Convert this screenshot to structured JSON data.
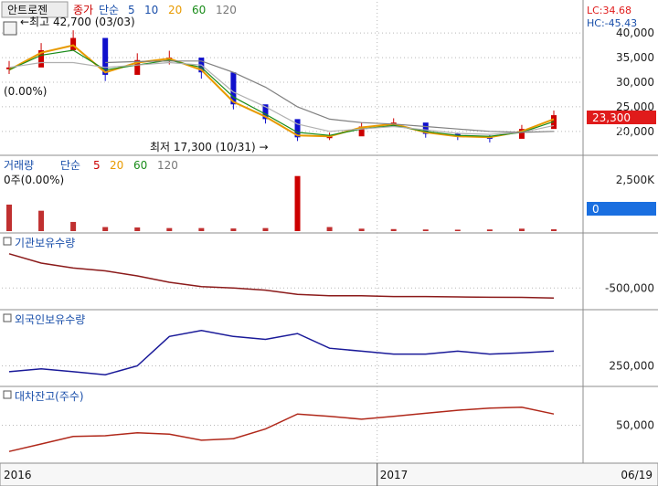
{
  "colors": {
    "price": "#cc0000",
    "price_down": "#1010cc",
    "ma5": "#e89a00",
    "ma10": "#1a8c1a",
    "ma20": "#b0b0b0",
    "inst": "#8b1a1a",
    "foreign": "#1a1a99",
    "loan": "#b0281a",
    "grid": "#b8b8b8",
    "label_blue": "#1a4faa",
    "badge_red": "#e01b1b",
    "badge_blue": "#1a6fe0"
  },
  "header": {
    "title": "안트로젠",
    "close_label": "종가",
    "ma_type": "단순",
    "ma_periods": [
      "5",
      "10",
      "20",
      "60",
      "120"
    ],
    "lc": "LC:34.68",
    "hc": "HC:-45.43"
  },
  "price_panel": {
    "high_label": "최고 42,700 (03/03)",
    "low_label": "최저 17,300 (10/31)",
    "change_label": "(0.00%)",
    "current_price": "23,300",
    "current_change": "0.00%",
    "y_ticks": [
      "40,000",
      "35,000",
      "30,000",
      "25,000",
      "20,000"
    ]
  },
  "volume_panel": {
    "title": "거래량",
    "ma_type": "단순",
    "ma_periods": [
      "5",
      "20",
      "60",
      "120"
    ],
    "sub_label": "0주(0.00%)",
    "current": "0",
    "current_change": "0.00%",
    "y_tick": "2,500K"
  },
  "inst_panel": {
    "title": "기관보유수량",
    "y_tick": "-500,000"
  },
  "foreign_panel": {
    "title": "외국인보유수량",
    "y_tick": "250,000"
  },
  "loan_panel": {
    "title": "대차잔고(주수)",
    "y_tick": "50,000"
  },
  "x_axis": {
    "labels": [
      "2016",
      "2017"
    ],
    "last_date": "06/19"
  },
  "chart_data": [
    {
      "type": "line",
      "title": "안트로젠 종가",
      "x": [
        "2016-01",
        "2016-02",
        "2016-03",
        "2016-04",
        "2016-05",
        "2016-06",
        "2016-07",
        "2016-08",
        "2016-09",
        "2016-10",
        "2016-11",
        "2016-12",
        "2017-01",
        "2017-02",
        "2017-03",
        "2017-04",
        "2017-05",
        "2017-06"
      ],
      "series": [
        {
          "name": "종가",
          "values": [
            33000,
            36500,
            39000,
            31500,
            34500,
            35000,
            32000,
            25500,
            22500,
            18800,
            19000,
            21000,
            21800,
            19500,
            19000,
            18500,
            20500,
            23300
          ]
        },
        {
          "name": "5",
          "values": [
            32500,
            36000,
            37500,
            32000,
            34000,
            34800,
            32500,
            26000,
            23000,
            19200,
            19000,
            20800,
            21500,
            19800,
            19000,
            18800,
            20000,
            22500
          ]
        },
        {
          "name": "10",
          "values": [
            32500,
            35500,
            36500,
            32500,
            33500,
            34500,
            33000,
            27000,
            23500,
            19800,
            19200,
            20500,
            21200,
            20000,
            19200,
            19000,
            19800,
            22000
          ]
        },
        {
          "name": "20",
          "values": [
            33000,
            34000,
            34000,
            33000,
            33500,
            34000,
            33500,
            28000,
            25000,
            21500,
            20000,
            20500,
            21000,
            20300,
            19600,
            19400,
            19800,
            21200
          ]
        },
        {
          "name": "60",
          "values": [
            null,
            null,
            null,
            34000,
            34200,
            34300,
            34300,
            32000,
            29000,
            25000,
            22500,
            21800,
            21500,
            21000,
            20500,
            20000,
            19800,
            20000
          ]
        }
      ],
      "ylim": [
        17000,
        43000
      ],
      "annotations": [
        "최고 42,700 (03/03)",
        "최저 17,300 (10/31)",
        "23,300"
      ]
    },
    {
      "type": "bar",
      "title": "거래량",
      "x": [
        "2016-01",
        "2016-02",
        "2016-03",
        "2016-04",
        "2016-05",
        "2016-06",
        "2016-07",
        "2016-08",
        "2016-09",
        "2016-10",
        "2016-11",
        "2016-12",
        "2017-01",
        "2017-02",
        "2017-03",
        "2017-04",
        "2017-05",
        "2017-06"
      ],
      "values": [
        1300000,
        1000000,
        450000,
        200000,
        180000,
        150000,
        150000,
        130000,
        150000,
        2700000,
        200000,
        120000,
        100000,
        80000,
        70000,
        80000,
        120000,
        90000
      ],
      "ylim": [
        0,
        3000000
      ]
    },
    {
      "type": "line",
      "title": "기관보유수량",
      "x": [
        "2016-01",
        "2016-02",
        "2016-03",
        "2016-04",
        "2016-05",
        "2016-06",
        "2016-07",
        "2016-08",
        "2016-09",
        "2016-10",
        "2016-11",
        "2016-12",
        "2017-01",
        "2017-02",
        "2017-03",
        "2017-04",
        "2017-05",
        "2017-06"
      ],
      "values": [
        -20000,
        -150000,
        -220000,
        -260000,
        -330000,
        -420000,
        -480000,
        -500000,
        -530000,
        -590000,
        -610000,
        -610000,
        -620000,
        -620000,
        -625000,
        -630000,
        -632000,
        -640000
      ]
    },
    {
      "type": "line",
      "title": "외국인보유수량",
      "x": [
        "2016-01",
        "2016-02",
        "2016-03",
        "2016-04",
        "2016-05",
        "2016-06",
        "2016-07",
        "2016-08",
        "2016-09",
        "2016-10",
        "2016-11",
        "2016-12",
        "2017-01",
        "2017-02",
        "2017-03",
        "2017-04",
        "2017-05",
        "2017-06"
      ],
      "values": [
        240000,
        245000,
        240000,
        235000,
        250000,
        300000,
        310000,
        300000,
        295000,
        305000,
        280000,
        275000,
        270000,
        270000,
        275000,
        270000,
        272000,
        275000
      ]
    },
    {
      "type": "line",
      "title": "대차잔고(주수)",
      "x": [
        "2016-01",
        "2016-02",
        "2016-03",
        "2016-04",
        "2016-05",
        "2016-06",
        "2016-07",
        "2016-08",
        "2016-09",
        "2016-10",
        "2016-11",
        "2016-12",
        "2017-01",
        "2017-02",
        "2017-03",
        "2017-04",
        "2017-05",
        "2017-06"
      ],
      "values": [
        15000,
        25000,
        35000,
        36000,
        40000,
        38000,
        30000,
        32000,
        45000,
        65000,
        62000,
        58000,
        62000,
        66000,
        70000,
        73000,
        74000,
        65000
      ]
    }
  ]
}
